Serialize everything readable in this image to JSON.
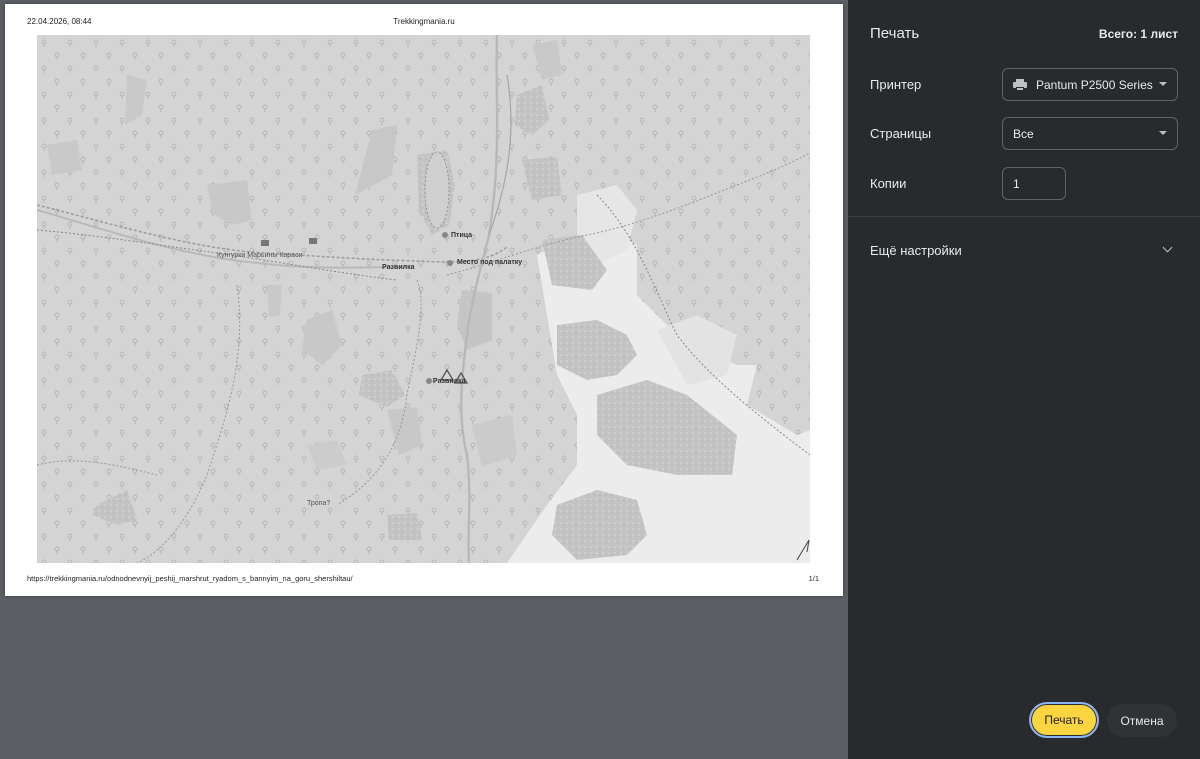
{
  "preview": {
    "header_date": "22.04.2026, 08:44",
    "header_site": "Trekkingmania.ru",
    "footer_url": "https://trekkingmania.ru/odnodnevnyij_peshij_marshrut_ryadom_s_bannyim_na_goru_shershiltau/",
    "footer_page": "1/1",
    "map_labels": {
      "bird": "Птица",
      "fork_1": "Развилка",
      "tent_place": "Место под палатку",
      "fork_2": "Развилка",
      "trail": "Тропа?",
      "village": "Кунгурки Марьины Караси"
    }
  },
  "panel": {
    "title": "Печать",
    "total": "Всего: 1 лист",
    "printer_label": "Принтер",
    "printer_value": "Pantum P2500 Series",
    "pages_label": "Страницы",
    "pages_value": "Все",
    "copies_label": "Копии",
    "copies_value": "1",
    "more_settings": "Ещё настройки",
    "print_button": "Печать",
    "cancel_button": "Отмена"
  }
}
